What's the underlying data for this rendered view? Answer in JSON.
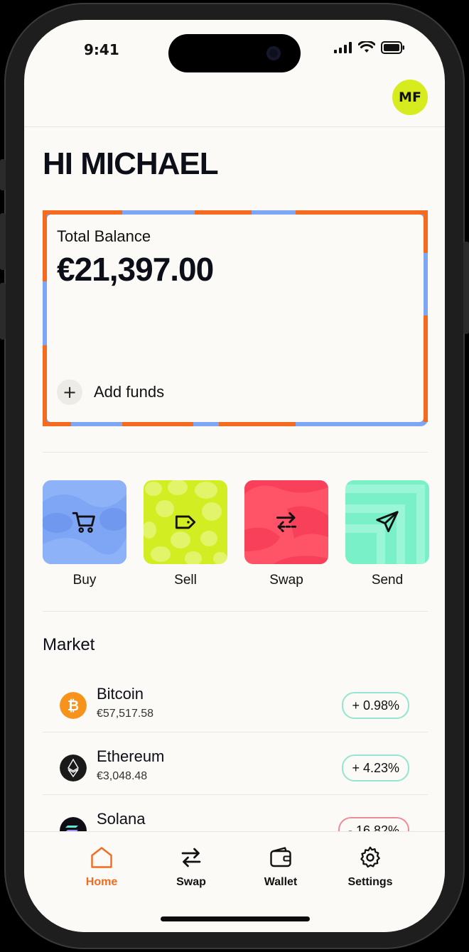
{
  "status": {
    "time": "9:41"
  },
  "user": {
    "initials": "MF",
    "greeting": "HI MICHAEL"
  },
  "balance": {
    "label": "Total Balance",
    "value": "€21,397.00",
    "add_funds": "Add funds"
  },
  "actions": [
    {
      "label": "Buy",
      "icon": "cart-icon",
      "color": "#7fa6f5"
    },
    {
      "label": "Sell",
      "icon": "tag-icon",
      "color": "#d2ee22"
    },
    {
      "label": "Swap",
      "icon": "swap-arrows-icon",
      "color": "#ff5468"
    },
    {
      "label": "Send",
      "icon": "send-icon",
      "color": "#7af0c8"
    }
  ],
  "market": {
    "title": "Market",
    "coins": [
      {
        "name": "Bitcoin",
        "price": "€57,517.58",
        "change": "+ 0.98%",
        "trend": "up",
        "icon": "bitcoin-icon"
      },
      {
        "name": "Ethereum",
        "price": "€3,048.48",
        "change": "+ 4.23%",
        "trend": "up",
        "icon": "ethereum-icon"
      },
      {
        "name": "Solana",
        "price": "",
        "change": "- 16.82%",
        "trend": "down",
        "icon": "solana-icon"
      }
    ]
  },
  "tabs": [
    {
      "label": "Home",
      "icon": "home-icon",
      "active": true
    },
    {
      "label": "Swap",
      "icon": "swap-icon",
      "active": false
    },
    {
      "label": "Wallet",
      "icon": "wallet-icon",
      "active": false
    },
    {
      "label": "Settings",
      "icon": "gear-icon",
      "active": false
    }
  ],
  "colors": {
    "accent": "#f46a1e",
    "up": "#93e6cf",
    "down": "#ef8b98",
    "avatar": "#d6ec1f"
  }
}
